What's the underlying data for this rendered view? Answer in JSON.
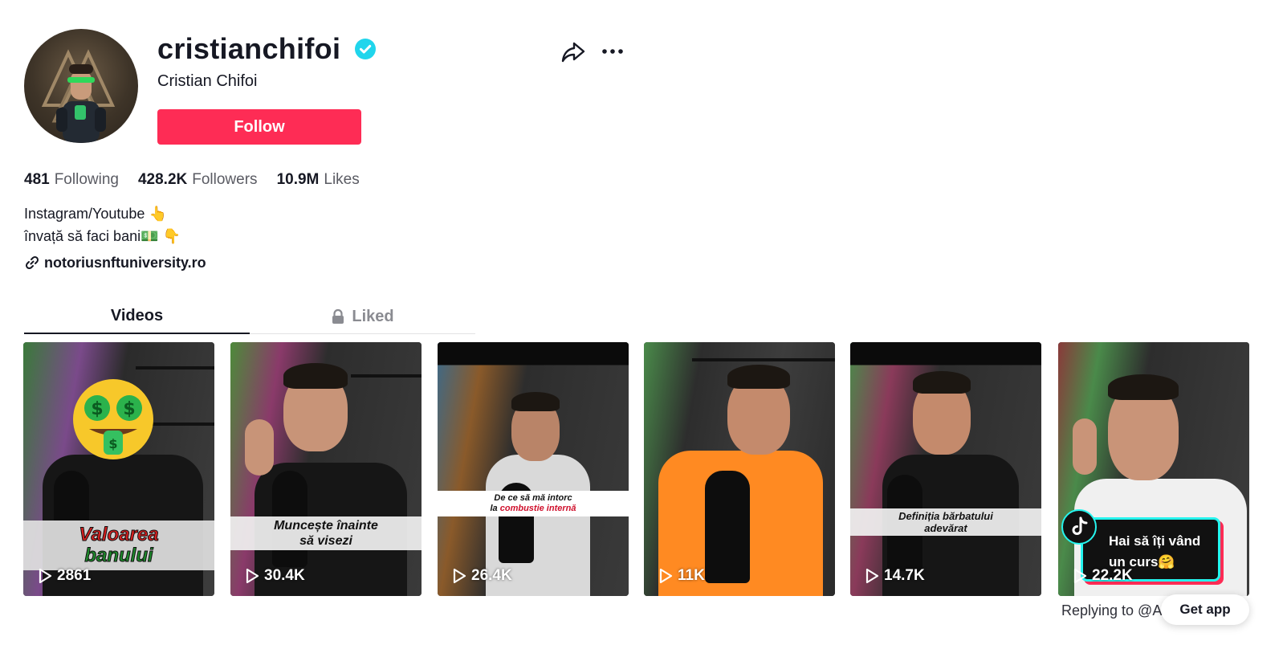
{
  "profile": {
    "username": "cristianchifoi",
    "display_name": "Cristian Chifoi",
    "follow_label": "Follow",
    "verified": true
  },
  "stats": {
    "following_count": "481",
    "following_label": "Following",
    "followers_count": "428.2K",
    "followers_label": "Followers",
    "likes_count": "10.9M",
    "likes_label": "Likes"
  },
  "bio": {
    "line1": "Instagram/Youtube 👆",
    "line2": "învață să faci bani💵 👇",
    "link": "notoriusnftuniversity.ro"
  },
  "tabs": {
    "videos": "Videos",
    "liked": "Liked"
  },
  "videos": [
    {
      "views": "2861",
      "caption_line1": "Valoarea",
      "caption_line2": "banului"
    },
    {
      "views": "30.4K",
      "caption_line1": "Muncește înainte",
      "caption_line2": "să visezi"
    },
    {
      "views": "26.4K",
      "caption_line1": "De ce să mă intorc",
      "caption_line2_prefix": "la ",
      "caption_line2_highlight": "combustie internă"
    },
    {
      "views": "11K"
    },
    {
      "views": "14.7K",
      "caption_line1": "Definiția bărbatului",
      "caption_line2": "adevărat"
    },
    {
      "views": "22.2K",
      "caption_line1": "Hai să îți vând",
      "caption_line2": "un curs🤗"
    }
  ],
  "footer": {
    "replying": "Replying to @A",
    "get_app": "Get app"
  },
  "colors": {
    "accent": "#fe2c55",
    "verified": "#20d5ec",
    "text_primary": "#161823",
    "text_secondary": "#5a5b63"
  },
  "icons": [
    "verified-badge-icon",
    "share-icon",
    "more-icon",
    "link-icon",
    "lock-icon",
    "play-icon",
    "tiktok-logo-icon"
  ]
}
